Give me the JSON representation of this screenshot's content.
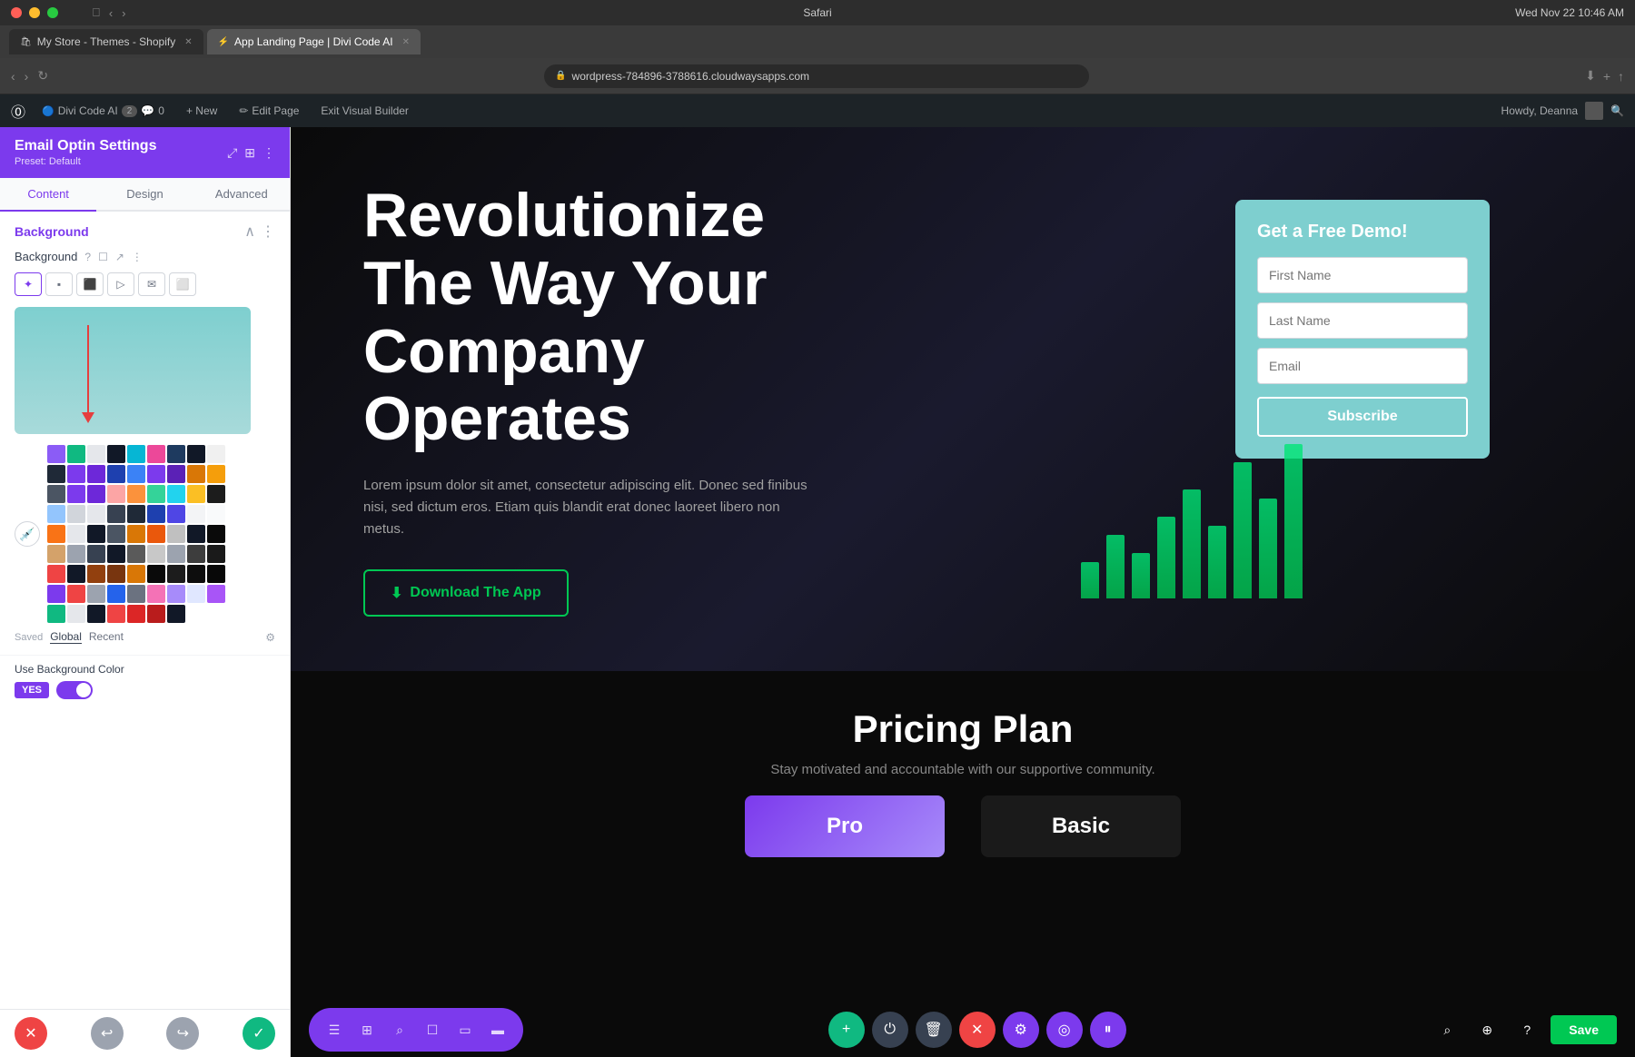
{
  "os": {
    "titlebar": "Safari",
    "time": "Wed Nov 22  10:46 AM"
  },
  "browser": {
    "tabs": [
      {
        "id": "shopify",
        "label": "My Store - Themes - Shopify",
        "active": false,
        "favicon": "🛍"
      },
      {
        "id": "wp",
        "label": "App Landing Page | Divi Code AI",
        "active": true,
        "favicon": "⚡"
      }
    ],
    "address": "wordpress-784896-3788616.cloudwaysapps.com",
    "lock_icon": "🔒"
  },
  "wp_toolbar": {
    "divi_label": "Divi Code AI",
    "revisions": "2",
    "comments": "0",
    "new_label": "+ New",
    "edit_label": "Edit Page",
    "exit_label": "Exit Visual Builder",
    "howdy": "Howdy, Deanna"
  },
  "left_panel": {
    "title": "Email Optin Settings",
    "preset": "Preset: Default",
    "tabs": [
      "Content",
      "Design",
      "Advanced"
    ],
    "active_tab": "Content",
    "section": {
      "title": "Background",
      "bg_label": "Background",
      "bg_types": [
        "✦",
        "▪",
        "☰",
        "▤",
        "✉",
        "☐"
      ]
    },
    "color_preview": {
      "bg_color": "#7ecfcf",
      "gradient_direction": "to bottom"
    },
    "saved_label": "Saved",
    "global_label": "Global",
    "recent_label": "Recent",
    "use_bg_color_label": "Use Background Color",
    "toggle_yes": "YES"
  },
  "hero": {
    "title": "Revolutionize The Way Your Company Operates",
    "description": "Lorem ipsum dolor sit amet, consectetur adipiscing elit. Donec sed finibus nisi, sed dictum eros. Etiam quis blandit erat donec laoreet libero non metus.",
    "cta_button": "Download The App",
    "cta_icon": "⬇"
  },
  "demo_form": {
    "title": "Get a Free Demo!",
    "first_name_placeholder": "First Name",
    "last_name_placeholder": "Last Name",
    "email_placeholder": "Email",
    "subscribe_label": "Subscribe"
  },
  "pricing": {
    "title": "Pricing Plan",
    "subtitle": "Stay motivated and accountable with our supportive community.",
    "cards": [
      {
        "name": "Pro",
        "highlighted": true
      },
      {
        "name": "Basic",
        "highlighted": false
      }
    ]
  },
  "bottom_toolbar": {
    "left_icons": [
      "☰",
      "⊞",
      "⌕",
      "☐",
      "▭",
      "▬"
    ],
    "center_buttons": [
      {
        "icon": "+",
        "color": "green"
      },
      {
        "icon": "⏻",
        "color": "dark"
      },
      {
        "icon": "🗑",
        "color": "dark"
      },
      {
        "icon": "✕",
        "color": "red"
      },
      {
        "icon": "⚙",
        "color": "purple"
      },
      {
        "icon": "◎",
        "color": "purple"
      },
      {
        "icon": "⏸",
        "color": "purple"
      }
    ],
    "right_icons": [
      "⌕",
      "⊕",
      "?"
    ],
    "save_label": "Save"
  },
  "panel_bottom": {
    "cancel_icon": "✕",
    "undo_icon": "↩",
    "redo_icon": "↪",
    "confirm_icon": "✓"
  },
  "colors": {
    "swatches_row1": [
      "#8b5cf6",
      "#10b981",
      "#e5e7eb",
      "#111827",
      "#06b6d4",
      "#ec4899",
      "#1e40af",
      "#111827",
      "#e5e7eb"
    ],
    "swatches_row2": [
      "#111827",
      "#7c3aed",
      "#6d28d9",
      "#1e40af",
      "#1d4ed8",
      "#7c3aed",
      "#6d28d9",
      "#d97706",
      "#d97706"
    ],
    "swatches_row3": [
      "#6b7280",
      "#7c3aed",
      "#6d28d9",
      "#ec4899",
      "#d97706",
      "#10b981",
      "#22d3ee",
      "#fbbf24",
      "#111827"
    ],
    "swatches_row4": [
      "#60a5fa",
      "#9ca3af",
      "#d1d5db",
      "#374151",
      "#1f2937",
      "#1e40af",
      "#4338ca",
      "#e5e7eb",
      "#f9fafb"
    ],
    "swatches_row5": [
      "#f97316",
      "#e5e7eb",
      "#111827",
      "#374151",
      "#d97706",
      "#ea580c",
      "#d1d5db",
      "#111827",
      "#111827"
    ],
    "swatches_row6": [
      "#d4a76a",
      "#9ca3af",
      "#374151",
      "#111827",
      "#6b7280",
      "#d1d5db",
      "#9ca3af",
      "#374151",
      "#111827"
    ],
    "swatches_row7": [
      "#ef4444",
      "#111827",
      "#92400e",
      "#78350f",
      "#d97706",
      "#111827",
      "#1a1a1a",
      "#111827",
      "#111827"
    ],
    "swatches_row8": [
      "#7c3aed",
      "#ef4444",
      "#9ca3af",
      "#1e40af",
      "#9ca3af",
      "#ec4899",
      "#a78bfa",
      "#e5e7eb",
      "#a78bfa"
    ],
    "swatches_row9": [
      "#10b981",
      "#e5e7eb",
      "#111827",
      "#ef4444",
      "#dc2626",
      "#b91c1c",
      "#111827"
    ]
  }
}
